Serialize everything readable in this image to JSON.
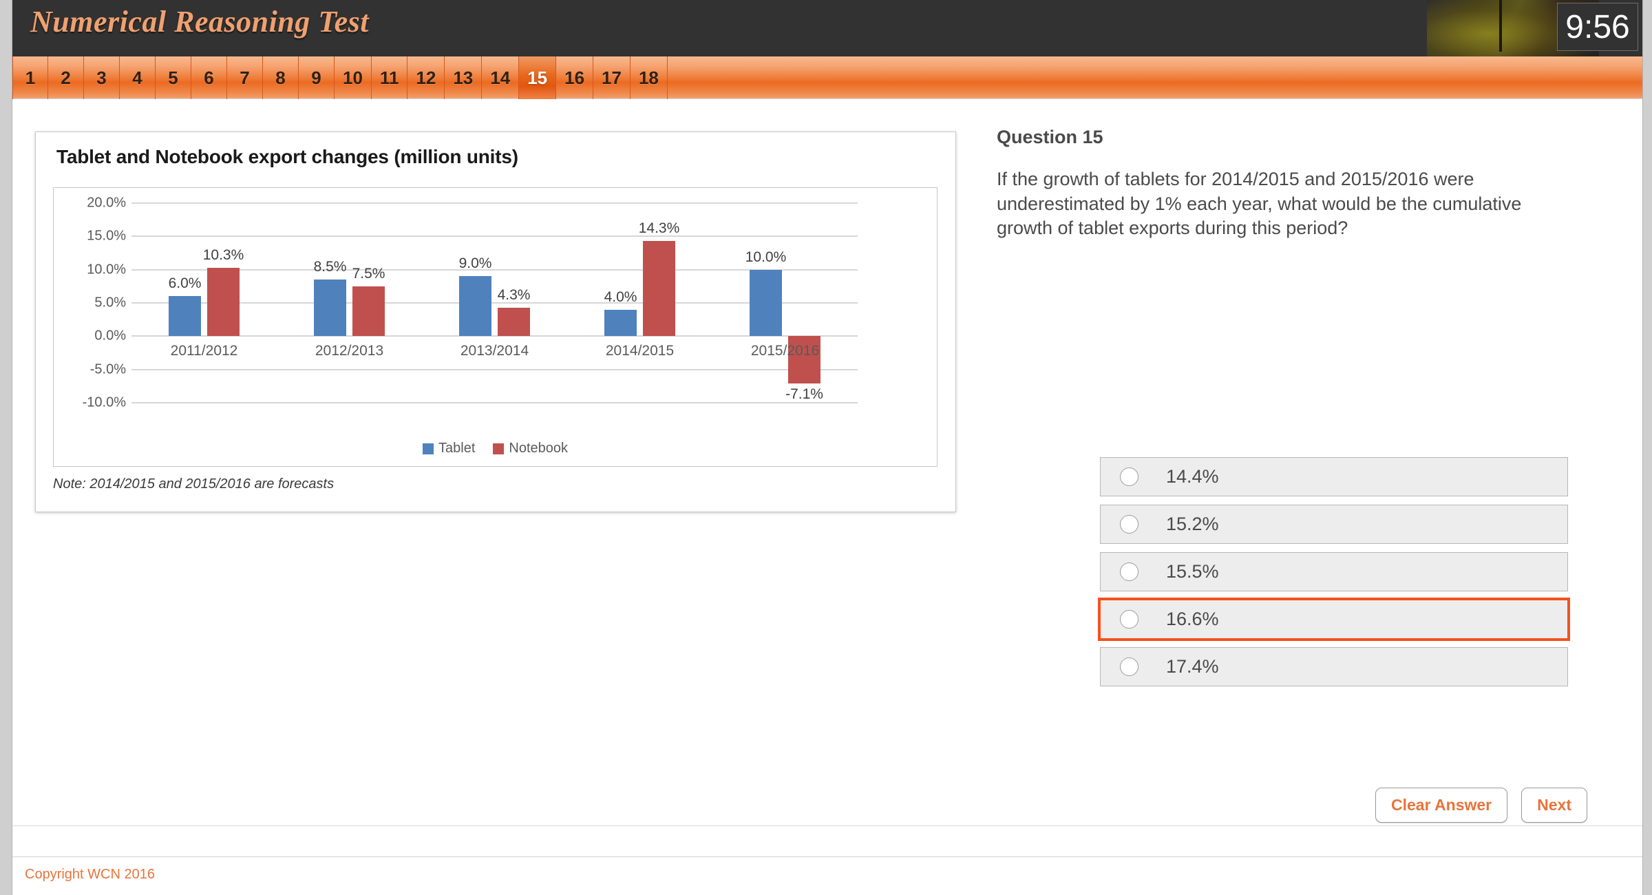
{
  "header": {
    "title": "Numerical Reasoning Test",
    "timer": "9:56"
  },
  "tabs": {
    "items": [
      "1",
      "2",
      "3",
      "4",
      "5",
      "6",
      "7",
      "8",
      "9",
      "10",
      "11",
      "12",
      "13",
      "14",
      "15",
      "16",
      "17",
      "18"
    ],
    "active": "15"
  },
  "chart_card": {
    "title": "Tablet and Notebook export changes (million units)",
    "note": "Note:  2014/2015 and 2015/2016 are forecasts"
  },
  "chart_data": {
    "type": "bar",
    "title": "Tablet and Notebook export changes (million units)",
    "xlabel": "",
    "ylabel": "",
    "ylim": [
      -10,
      20
    ],
    "ytick_labels": [
      "20.0%",
      "15.0%",
      "10.0%",
      "5.0%",
      "0.0%",
      "-5.0%",
      "-10.0%"
    ],
    "ytick_values": [
      20,
      15,
      10,
      5,
      0,
      -5,
      -10
    ],
    "grid": true,
    "legend_position": "bottom",
    "categories": [
      "2011/2012",
      "2012/2013",
      "2013/2014",
      "2014/2015",
      "2015/2016"
    ],
    "series": [
      {
        "name": "Tablet",
        "color": "#4f81bd",
        "values": [
          6.0,
          8.5,
          9.0,
          4.0,
          10.0
        ],
        "labels": [
          "6.0%",
          "8.5%",
          "9.0%",
          "4.0%",
          "10.0%"
        ]
      },
      {
        "name": "Notebook",
        "color": "#c0504d",
        "values": [
          10.3,
          7.5,
          4.3,
          14.3,
          -7.1
        ],
        "labels": [
          "10.3%",
          "7.5%",
          "4.3%",
          "14.3%",
          "-7.1%"
        ]
      }
    ],
    "annotations": [
      "Note:  2014/2015 and 2015/2016 are forecasts"
    ]
  },
  "question": {
    "heading": "Question 15",
    "text": "If the growth of tablets for 2014/2015 and 2015/2016 were underestimated by 1% each year, what would be the cumulative growth of tablet exports during this period?",
    "options": [
      {
        "label": "14.4%",
        "selected": false,
        "focused": false
      },
      {
        "label": "15.2%",
        "selected": false,
        "focused": false
      },
      {
        "label": "15.5%",
        "selected": false,
        "focused": false
      },
      {
        "label": "16.6%",
        "selected": false,
        "focused": true
      },
      {
        "label": "17.4%",
        "selected": false,
        "focused": false
      }
    ]
  },
  "actions": {
    "clear_label": "Clear Answer",
    "next_label": "Next"
  },
  "footer": {
    "copyright": "Copyright WCN 2016"
  },
  "colors": {
    "brand_orange": "#e8743b",
    "focus_outline": "#f4511e",
    "tablet": "#4f81bd",
    "notebook": "#c0504d",
    "header_bg": "#323232"
  }
}
